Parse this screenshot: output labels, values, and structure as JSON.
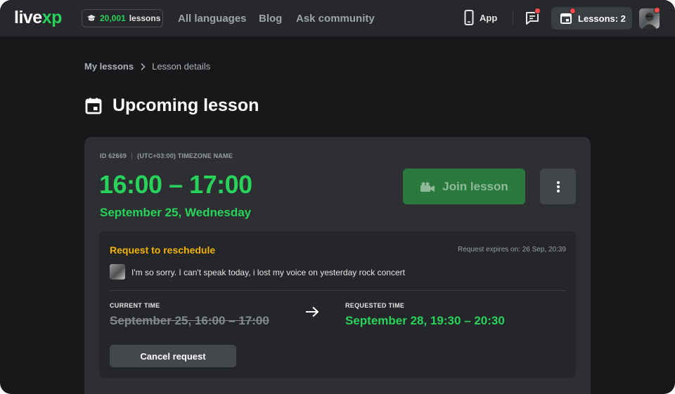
{
  "topbar": {
    "logo_main": "live",
    "logo_accent": "xp",
    "lessons_count": "20,001",
    "lessons_word": "lessons",
    "nav": [
      "All languages",
      "Blog",
      "Ask community"
    ],
    "app_label": "App",
    "lessons_button": "Lessons: 2",
    "accent_color": "#27d35a",
    "notification_color": "#ff4a4a"
  },
  "breadcrumb": {
    "parent": "My lessons",
    "current": "Lesson details"
  },
  "page": {
    "title": "Upcoming lesson"
  },
  "lesson": {
    "id_label": "ID 62669",
    "timezone": "(UTC+03:00) TIMEZONE NAME",
    "time_range": "16:00 – 17:00",
    "date": "September 25, Wednesday",
    "join_label": "Join lesson"
  },
  "request": {
    "title": "Request to reschedule",
    "expires": "Request expires on: 26 Sep, 20:39",
    "message": "I'm so sorry. I can't speak today, i lost my voice on yesterday rock concert",
    "current_label": "CURRENT TIME",
    "current_value": "September 25, 16:00 – 17:00",
    "requested_label": "REQUESTED TIME",
    "requested_value": "September 28, 19:30 – 20:30",
    "cancel_label": "Cancel request",
    "title_color": "#f2b300"
  },
  "icons": {
    "lessons_pill": "graduation-cap-icon",
    "app": "phone-icon",
    "chat": "chat-icon",
    "calendar": "calendar-icon",
    "join": "video-camera-icon",
    "more": "more-vertical-icon",
    "arrow": "arrow-right-icon",
    "breadcrumb": "chevron-right-icon"
  }
}
